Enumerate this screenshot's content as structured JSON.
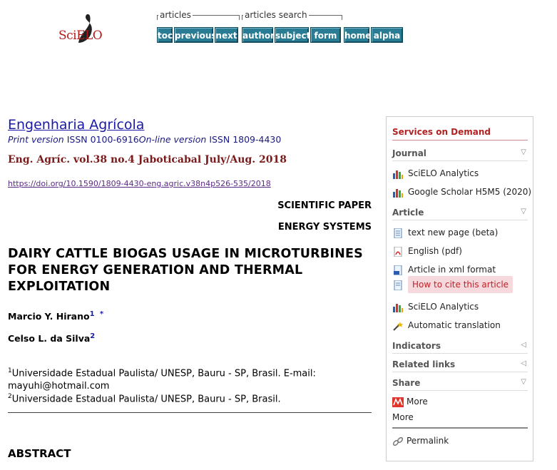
{
  "logo": {
    "text": "SciELO"
  },
  "nav": {
    "group_articles": "articles",
    "group_search": "articles search",
    "buttons": [
      "toc",
      "previous",
      "next",
      "author",
      "subject",
      "form",
      "home",
      "alpha"
    ]
  },
  "main": {
    "journal_title": "Engenharia Agrícola",
    "issn_print_label": "Print version",
    "issn_print": "ISSN 0100-6916",
    "issn_online_label": "On-line version",
    "issn_online": "ISSN 1809-4430",
    "issue": "Eng. Agríc. vol.38 no.4 Jaboticabal July/Aug. 2018",
    "doi": "https://doi.org/10.1590/1809-4430-eng.agric.v38n4p526-535/2018",
    "section1": "SCIENTIFIC PAPER",
    "section2": "ENERGY SYSTEMS",
    "title": "DAIRY CATTLE BIOGAS USAGE IN MICROTURBINES FOR ENERGY GENERATION AND THERMAL EXPLOITATION",
    "author1": "Marcio Y. Hirano",
    "author1_sup1": "1",
    "author1_sup2": "*",
    "author2": "Celso L. da Silva",
    "author2_sup": "2",
    "aff1_num": "1",
    "aff1": "Universidade Estadual Paulista/ UNESP, Bauru - SP, Brasil. E-mail: mayuhi@hotmail.com",
    "aff2_num": "2",
    "aff2": "Universidade Estadual Paulista/ UNESP, Bauru - SP, Brasil.",
    "abstract_heading": "ABSTRACT"
  },
  "sidebar": {
    "heading": "Services on Demand",
    "journal": "Journal",
    "journal_items": [
      "SciELO Analytics",
      "Google Scholar H5M5 (2020)"
    ],
    "article": "Article",
    "article_items": [
      "text new page (beta)",
      "English (pdf)",
      "Article in xml format",
      "How to cite this article",
      "SciELO Analytics",
      "Automatic translation"
    ],
    "indicators": "Indicators",
    "related": "Related links",
    "share": "Share",
    "share_more1": "More",
    "share_more2": "More",
    "permalink": "Permalink"
  }
}
